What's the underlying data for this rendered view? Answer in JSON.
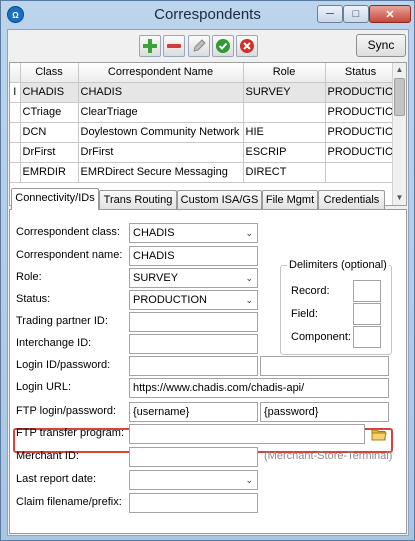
{
  "window": {
    "title": "Correspondents",
    "app_icon": "Ω"
  },
  "toolbar": {
    "buttons": [
      {
        "name": "add",
        "icon": "plus-icon",
        "color": "#3aa33a"
      },
      {
        "name": "remove",
        "icon": "minus-icon",
        "color": "#d33c3c"
      },
      {
        "name": "edit",
        "icon": "pencil-icon",
        "color": "#9a9a9a"
      },
      {
        "name": "accept",
        "icon": "checkmark-icon",
        "color": "#2f9a2f"
      },
      {
        "name": "cancel",
        "icon": "x-circle-icon",
        "color": "#d0302a"
      }
    ],
    "sync_label": "Sync"
  },
  "grid": {
    "columns": [
      "Class",
      "Correspondent Name",
      "Role",
      "Status"
    ],
    "rows": [
      {
        "cls": "CHADIS",
        "name": "CHADIS",
        "role": "SURVEY",
        "status": "PRODUCTION"
      },
      {
        "cls": "CTriage",
        "name": "ClearTriage",
        "role": "",
        "status": "PRODUCTION"
      },
      {
        "cls": "DCN",
        "name": "Doylestown Community Network",
        "role": "HIE",
        "status": "PRODUCTION"
      },
      {
        "cls": "DrFirst",
        "name": "DrFirst",
        "role": "ESCRIP",
        "status": "PRODUCTION"
      },
      {
        "cls": "EMRDIR",
        "name": "EMRDirect Secure Messaging",
        "role": "DIRECT",
        "status": ""
      }
    ],
    "selected_indicator": "I"
  },
  "tabs": [
    "Connectivity/IDs",
    "Trans Routing",
    "Custom ISA/GS",
    "File Mgmt",
    "Credentials"
  ],
  "form": {
    "correspondent_class": {
      "label": "Correspondent class:",
      "value": "CHADIS"
    },
    "correspondent_name": {
      "label": "Correspondent name:",
      "value": "CHADIS"
    },
    "role": {
      "label": "Role:",
      "value": "SURVEY"
    },
    "status": {
      "label": "Status:",
      "value": "PRODUCTION"
    },
    "trading_partner_id": {
      "label": "Trading partner ID:",
      "value": ""
    },
    "interchange_id": {
      "label": "Interchange ID:",
      "value": ""
    },
    "login_id_password": {
      "label": "Login ID/password:",
      "value": "",
      "password": ""
    },
    "login_url": {
      "label": "Login URL:",
      "value": "https://www.chadis.com/chadis-api/"
    },
    "ftp_login_password": {
      "label": "FTP login/password:",
      "value": "{username}",
      "password": "{password}"
    },
    "ftp_transfer_program": {
      "label": "FTP transfer program:",
      "value": ""
    },
    "merchant_id": {
      "label": "Merchant ID:",
      "value": "",
      "hint": "(Merchant-Store-Terminal)"
    },
    "last_report_date": {
      "label": "Last report date:",
      "value": ""
    },
    "claim_filename_prefix": {
      "label": "Claim filename/prefix:",
      "value": ""
    }
  },
  "delimiters": {
    "title": "Delimiters (optional)",
    "record_label": "Record:",
    "field_label": "Field:",
    "component_label": "Component:"
  },
  "colors": {
    "highlight": "#d9423a",
    "folder": "#e8b93a"
  }
}
